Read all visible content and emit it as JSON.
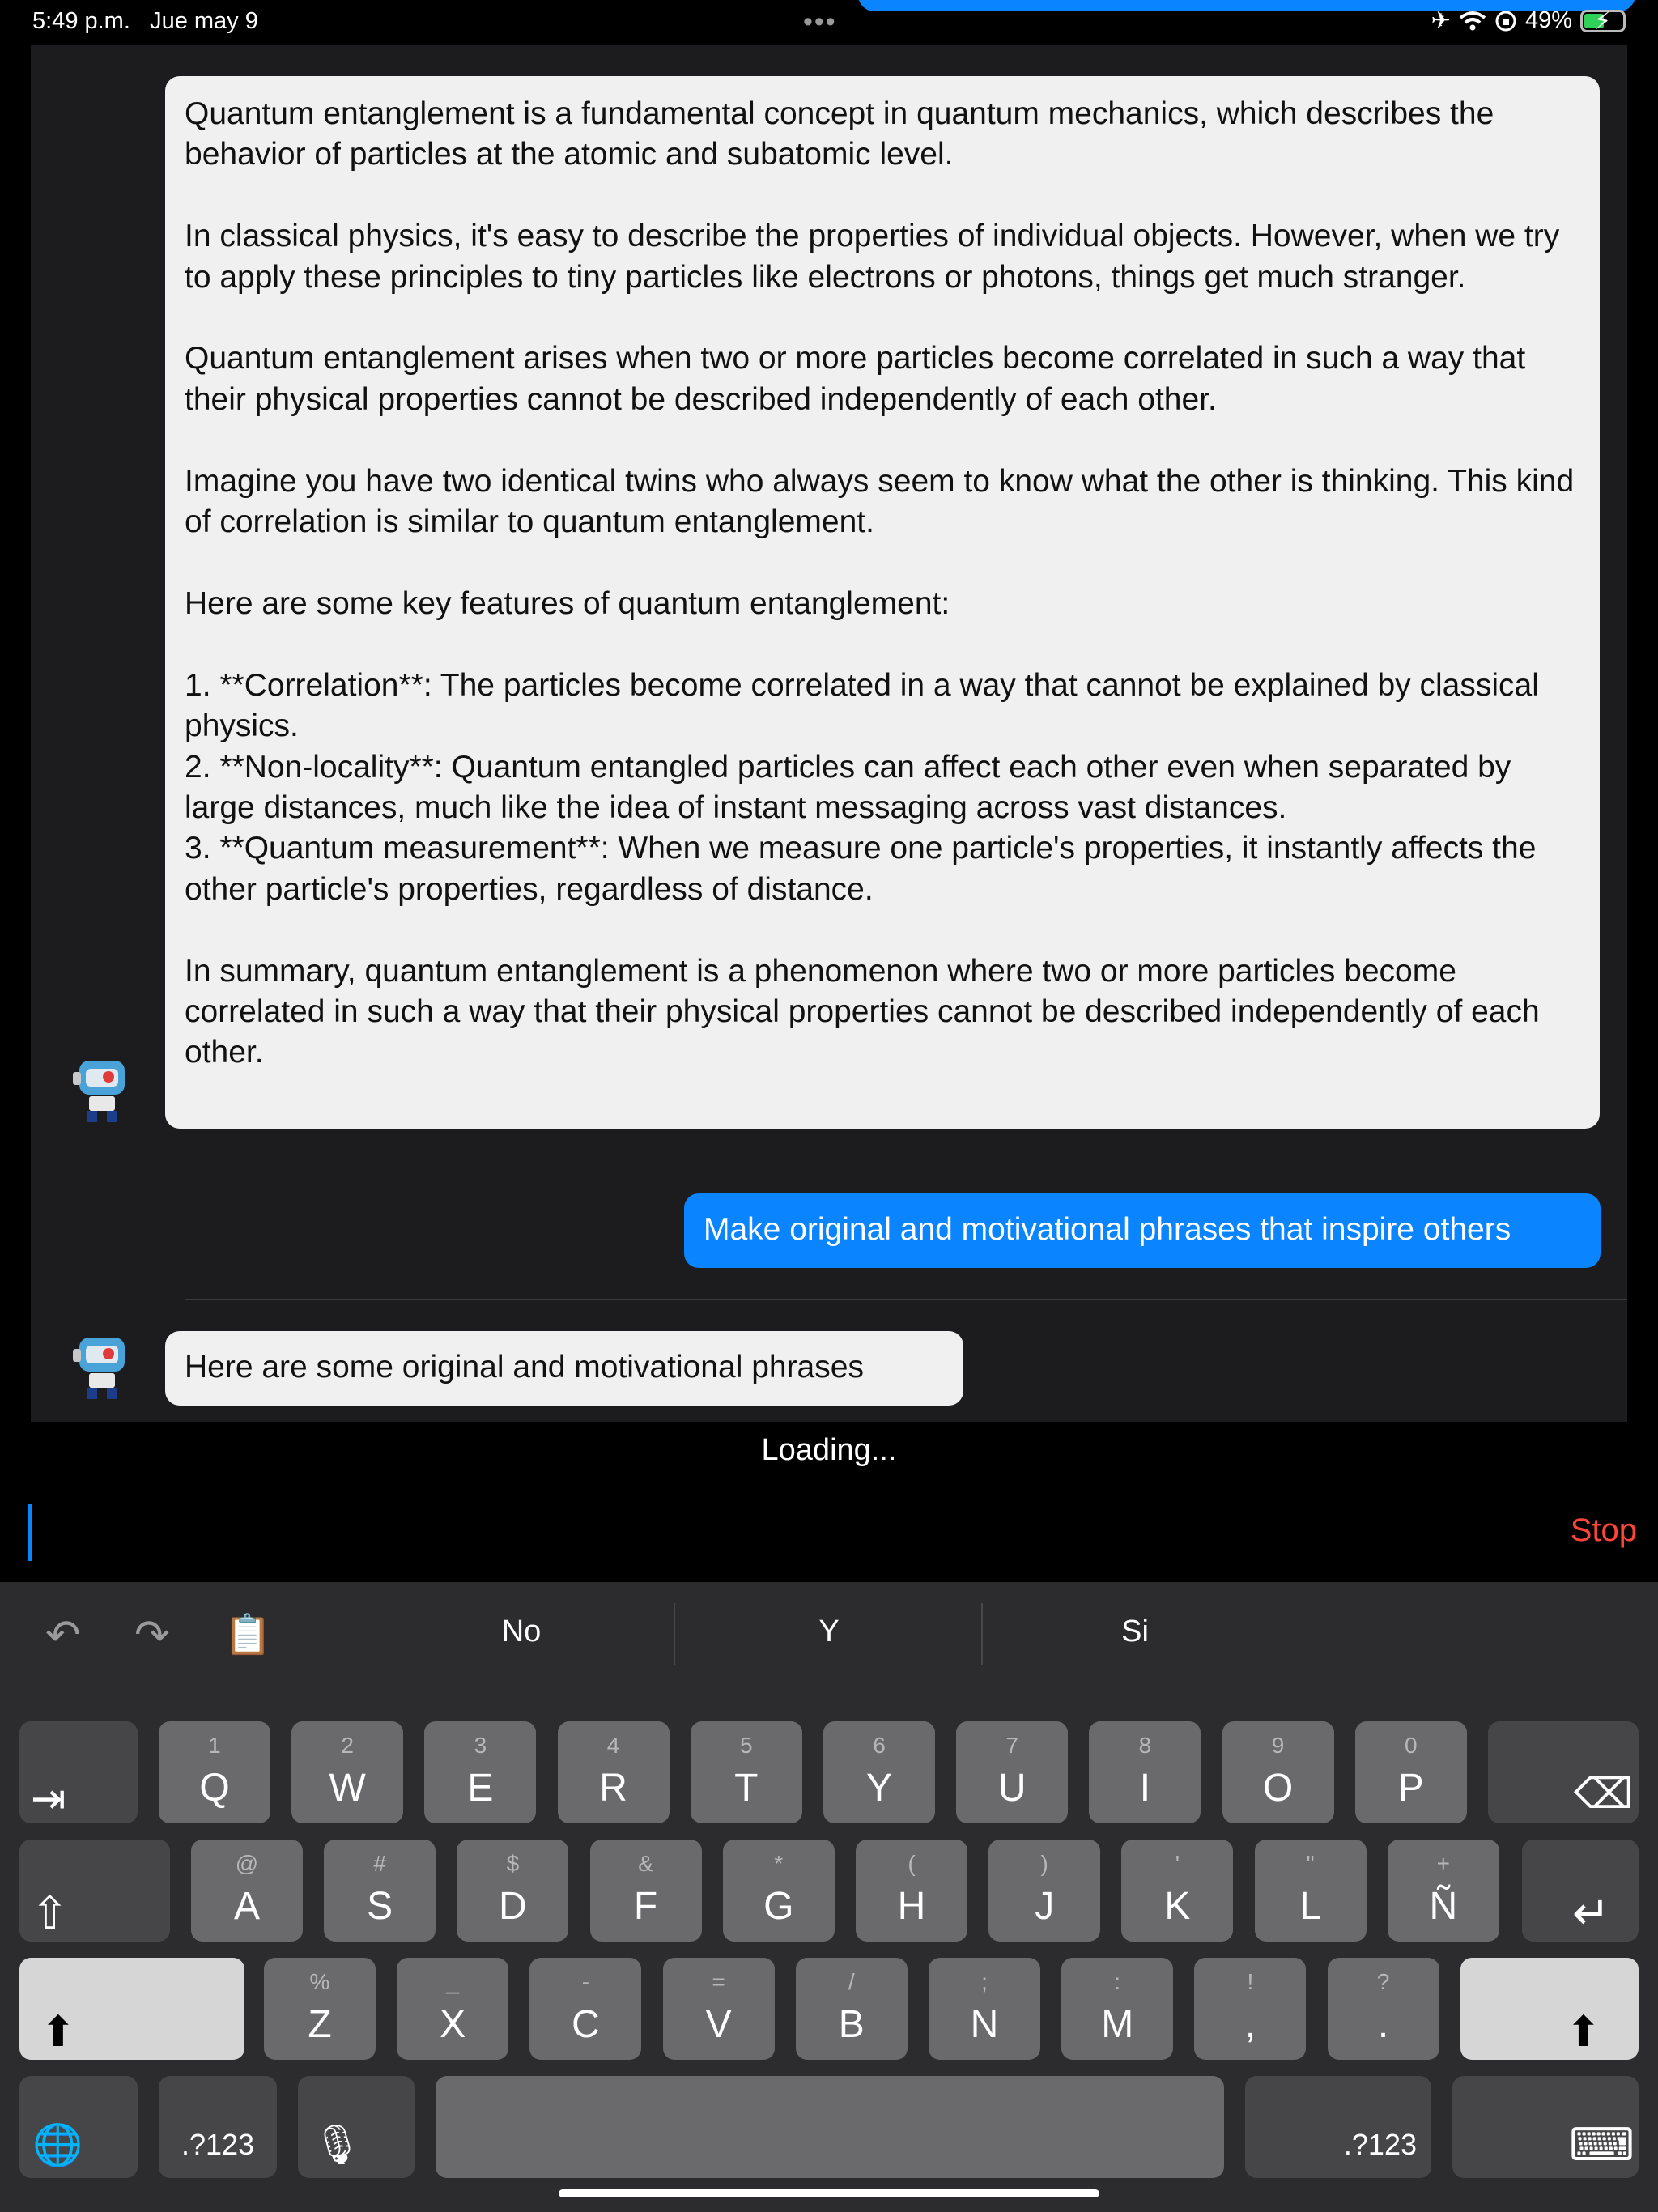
{
  "status_bar": {
    "time": "5:49 p.m.",
    "date": "Jue may 9",
    "battery": "49%",
    "icons": [
      "airplane-icon",
      "wifi-icon",
      "orientation-lock-icon",
      "battery-charging-icon"
    ]
  },
  "messages": [
    {
      "role": "assistant",
      "text": "Quantum entanglement is a fundamental concept in quantum mechanics, which describes the behavior of particles at the atomic and subatomic level.\n\nIn classical physics, it's easy to describe the properties of individual objects. However, when we try to apply these principles to tiny particles like electrons or photons, things get much stranger.\n\nQuantum entanglement arises when two or more particles become correlated in such a way that their physical properties cannot be described independently of each other.\n\nImagine you have two identical twins who always seem to know what the other is thinking. This kind of correlation is similar to quantum entanglement.\n\nHere are some key features of quantum entanglement:\n\n1. **Correlation**: The particles become correlated in a way that cannot be explained by classical physics.\n2. **Non-locality**: Quantum entangled particles can affect each other even when separated by large distances, much like the idea of instant messaging across vast distances.\n3. **Quantum measurement**: When we measure one particle's properties, it instantly affects the other particle's properties, regardless of distance.\n\nIn summary, quantum entanglement is a phenomenon where two or more particles become correlated in such a way that their physical properties cannot be described independently of each other."
    },
    {
      "role": "user",
      "text": "Make original and motivational phrases that inspire others"
    },
    {
      "role": "assistant",
      "text": "Here are some original and motivational phrases"
    }
  ],
  "loading_text": "Loading...",
  "stop_label": "Stop",
  "keyboard": {
    "suggestions": [
      "No",
      "Y",
      "Si"
    ],
    "row1": [
      {
        "sub": "1",
        "main": "Q"
      },
      {
        "sub": "2",
        "main": "W"
      },
      {
        "sub": "3",
        "main": "E"
      },
      {
        "sub": "4",
        "main": "R"
      },
      {
        "sub": "5",
        "main": "T"
      },
      {
        "sub": "6",
        "main": "Y"
      },
      {
        "sub": "7",
        "main": "U"
      },
      {
        "sub": "8",
        "main": "I"
      },
      {
        "sub": "9",
        "main": "O"
      },
      {
        "sub": "0",
        "main": "P"
      }
    ],
    "row2": [
      {
        "sub": "@",
        "main": "A"
      },
      {
        "sub": "#",
        "main": "S"
      },
      {
        "sub": "$",
        "main": "D"
      },
      {
        "sub": "&",
        "main": "F"
      },
      {
        "sub": "*",
        "main": "G"
      },
      {
        "sub": "(",
        "main": "H"
      },
      {
        "sub": ")",
        "main": "J"
      },
      {
        "sub": "'",
        "main": "K"
      },
      {
        "sub": "\"",
        "main": "L"
      },
      {
        "sub": "+",
        "main": "Ñ"
      }
    ],
    "row3": [
      {
        "sub": "%",
        "main": "Z"
      },
      {
        "sub": "_",
        "main": "X"
      },
      {
        "sub": "-",
        "main": "C"
      },
      {
        "sub": "=",
        "main": "V"
      },
      {
        "sub": "/",
        "main": "B"
      },
      {
        "sub": ";",
        "main": "N"
      },
      {
        "sub": ":",
        "main": "M"
      },
      {
        "sub": "!",
        "main": ","
      },
      {
        "sub": "?",
        "main": "."
      }
    ],
    "numbers_label": ".?123",
    "numbers_label_right": ".?123"
  }
}
